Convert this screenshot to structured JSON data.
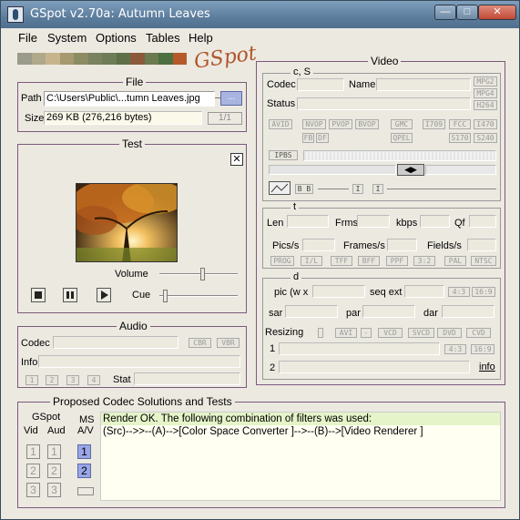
{
  "window": {
    "title": "GSpot v2.70a: Autumn Leaves"
  },
  "menu": [
    "File",
    "System",
    "Options",
    "Tables",
    "Help"
  ],
  "logo": "GSpot",
  "colors": {
    "swatches": [
      "#9b9b8b",
      "#b0a88a",
      "#c8b48c",
      "#a6996f",
      "#8c8c64",
      "#7a8260",
      "#6e7c58",
      "#5f7049",
      "#8a5a3a",
      "#6b7a50",
      "#4c7040",
      "#b65a2a"
    ]
  },
  "file": {
    "title": "File",
    "path_label": "Path",
    "path": "C:\\Users\\Public\\...tumn Leaves.jpg",
    "browse": "...",
    "size_label": "Size",
    "size": "269 KB (276,216 bytes)",
    "index": "1/1"
  },
  "test": {
    "title": "Test",
    "volume_label": "Volume",
    "cue_label": "Cue",
    "volume_level": 0.55,
    "cue_level": 0.05
  },
  "audio": {
    "title": "Audio",
    "codec_label": "Codec",
    "cbr": "CBR",
    "vbr": "VBR",
    "info_label": "Info",
    "channels": [
      "1",
      "2",
      "3",
      "4"
    ],
    "stat_label": "Stat"
  },
  "video": {
    "title": "Video",
    "cs_label": "c, S",
    "codec_label": "Codec",
    "name_label": "Name",
    "status_label": "Status",
    "fmt_right": [
      "MPG2",
      "MPG4",
      "H264"
    ],
    "row1": [
      "AVID",
      "NVOP",
      "PVOP",
      "BVOP",
      "GMC",
      "I709",
      "FCC",
      "I470"
    ],
    "row2": [
      "FB",
      "DF",
      "QPEL",
      "S170",
      "S240"
    ],
    "ipbs": "IPBS",
    "bb": "B B",
    "i1": "I",
    "i2": "I",
    "t_label": "t",
    "len_label": "Len",
    "frms_label": "Frms",
    "kbps_label": "kbps",
    "qf_label": "Qf",
    "pics_label": "Pics/s",
    "frames_label": "Frames/s",
    "fields_label": "Fields/s",
    "row3": [
      "PROG",
      "I/L",
      "TFF",
      "BFF",
      "PPF",
      "3:2",
      "PAL",
      "NTSC"
    ],
    "d_label": "d",
    "pic_label": "pic (w x",
    "seqext_label": "seq ext",
    "r43": "4:3",
    "r169": "16:9",
    "sar_label": "sar",
    "par_label": "par",
    "dar_label": "dar",
    "resizing_label": "Resizing",
    "avi": "AVI",
    "minus": "-",
    "vcd": "VCD",
    "svcd": "SVCD",
    "dvd": "DVD",
    "cvd": "CVD",
    "r1_label": "1",
    "r2_label": "2",
    "r43b": "4:3",
    "r169b": "16:9",
    "info_link": "info"
  },
  "proposed": {
    "title": "Proposed Codec Solutions and Tests",
    "gspot_label": "GSpot",
    "vid_label": "Vid",
    "aud_label": "Aud",
    "ms_label": "MS",
    "av_label": "A/V",
    "vid_buttons": [
      "1",
      "2",
      "3"
    ],
    "aud_buttons": [
      "1",
      "2",
      "3"
    ],
    "ms_buttons": [
      "1",
      "2"
    ],
    "line1": "Render OK.  The following combination of filters was used:",
    "line2": "(Src)-->>--(A)-->[Color Space Converter ]-->--(B)-->[Video Renderer ]"
  }
}
